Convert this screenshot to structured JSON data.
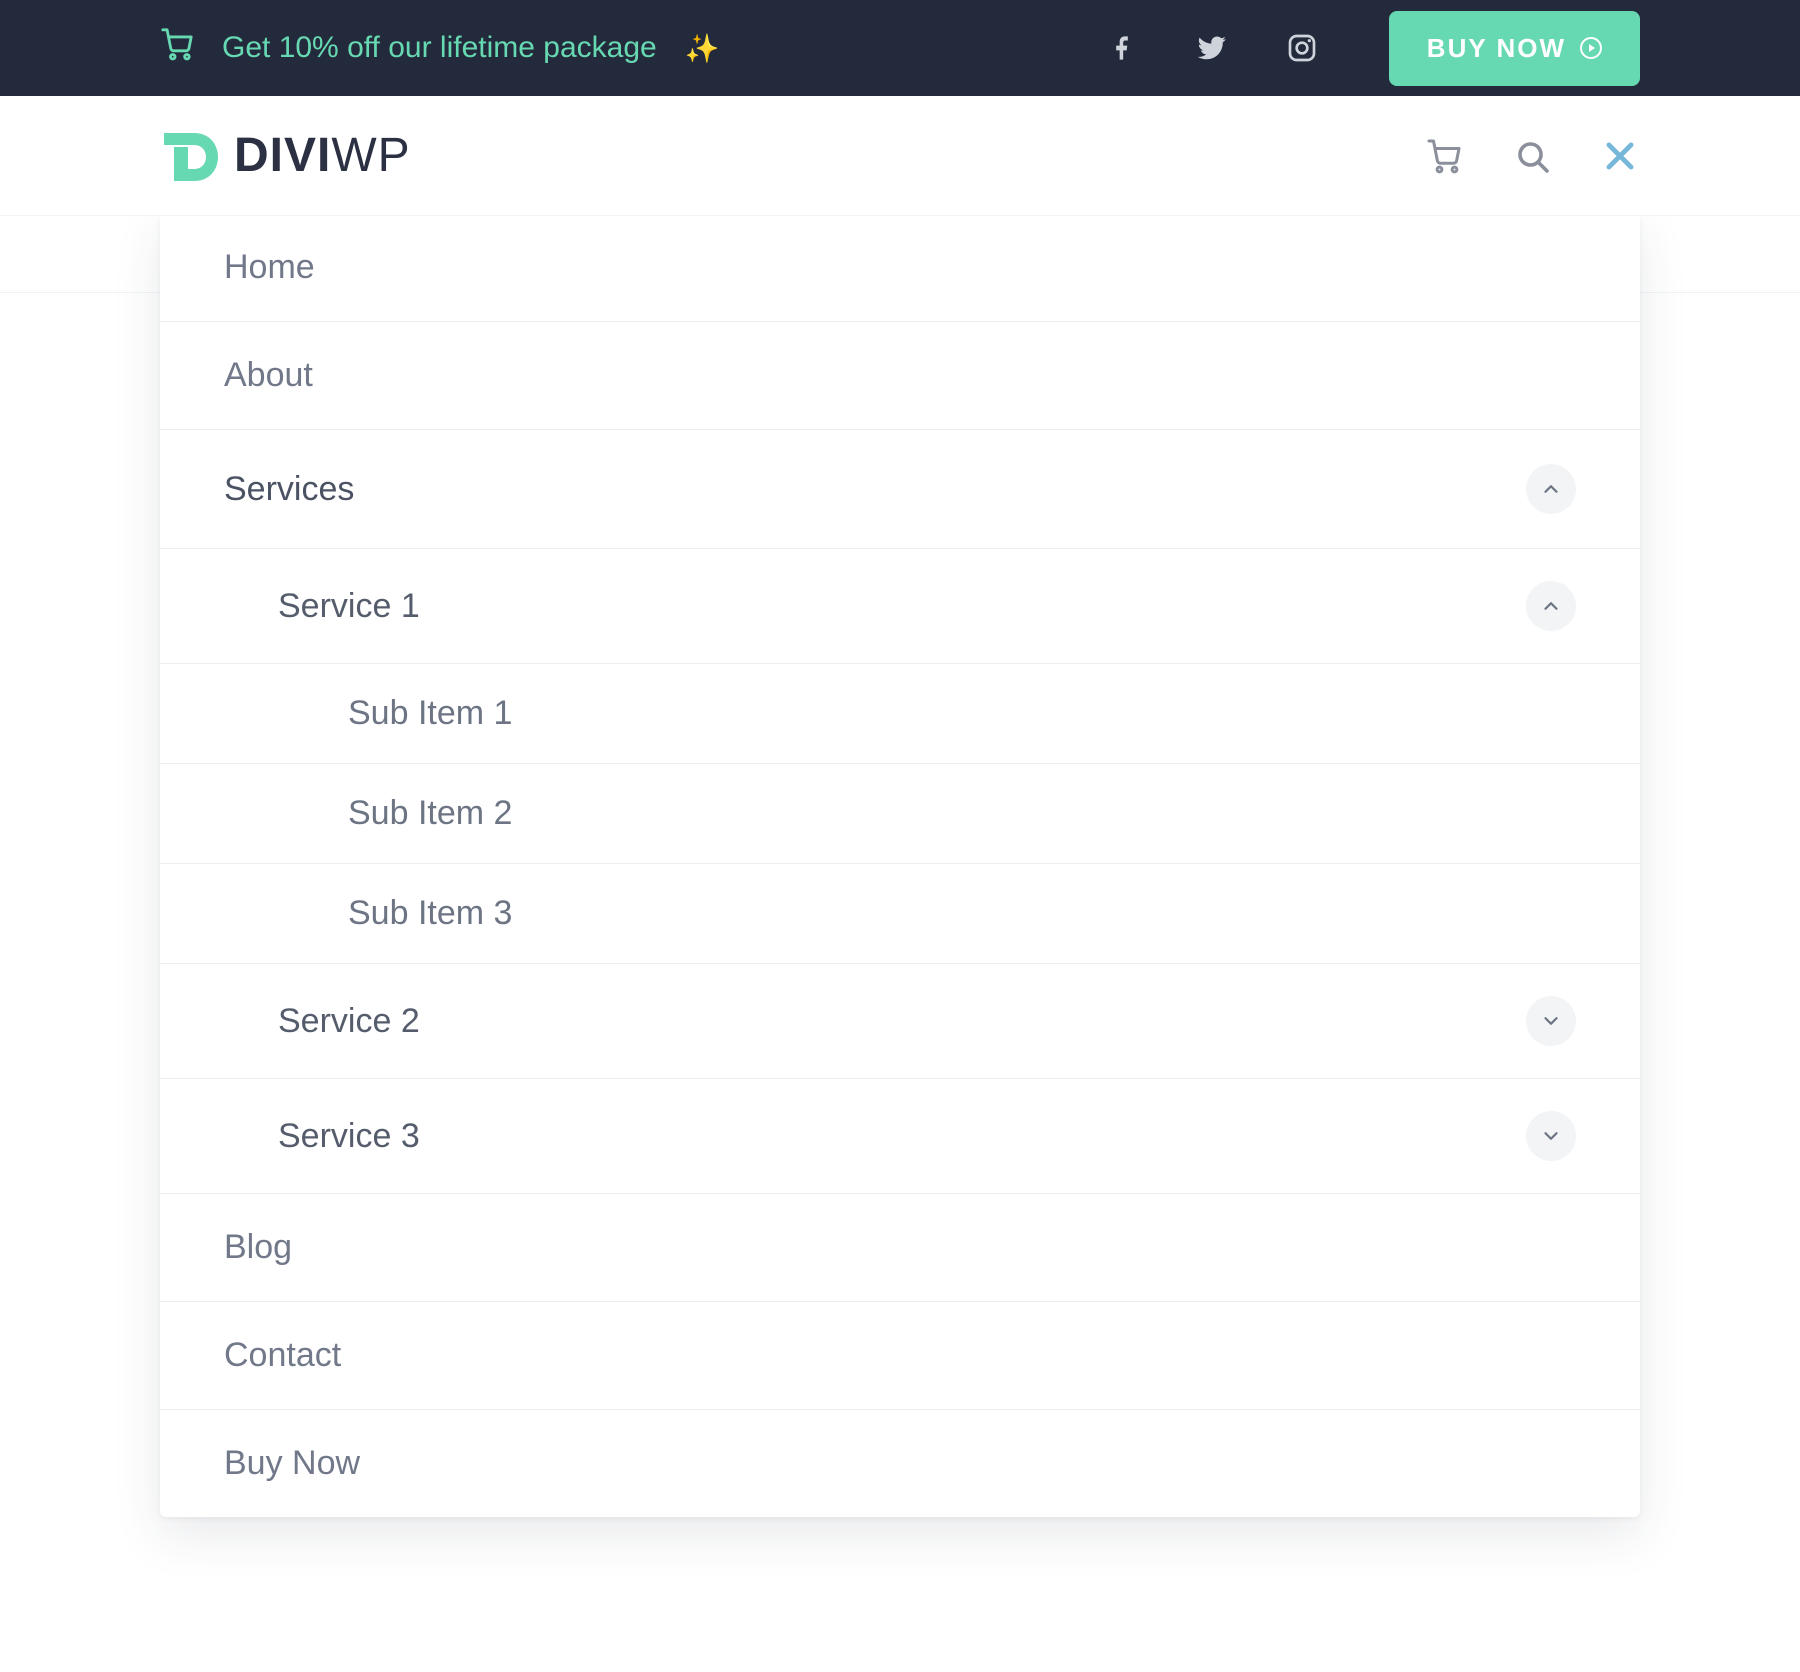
{
  "topbar": {
    "promo_text": "Get 10% off our lifetime package",
    "sparkle": "✨",
    "buy_label": "BUY NOW"
  },
  "brand": {
    "name_bold": "DIVI",
    "name_thin": "WP"
  },
  "menu": {
    "home": "Home",
    "about": "About",
    "services": "Services",
    "service1": "Service 1",
    "sub1": "Sub Item 1",
    "sub2": "Sub Item 2",
    "sub3": "Sub Item 3",
    "service2": "Service 2",
    "service3": "Service 3",
    "blog": "Blog",
    "contact": "Contact",
    "buy_now": "Buy Now"
  },
  "colors": {
    "accent": "#67d9b2",
    "topbar_bg": "#232a3b",
    "close_blue": "#76b6d8"
  }
}
